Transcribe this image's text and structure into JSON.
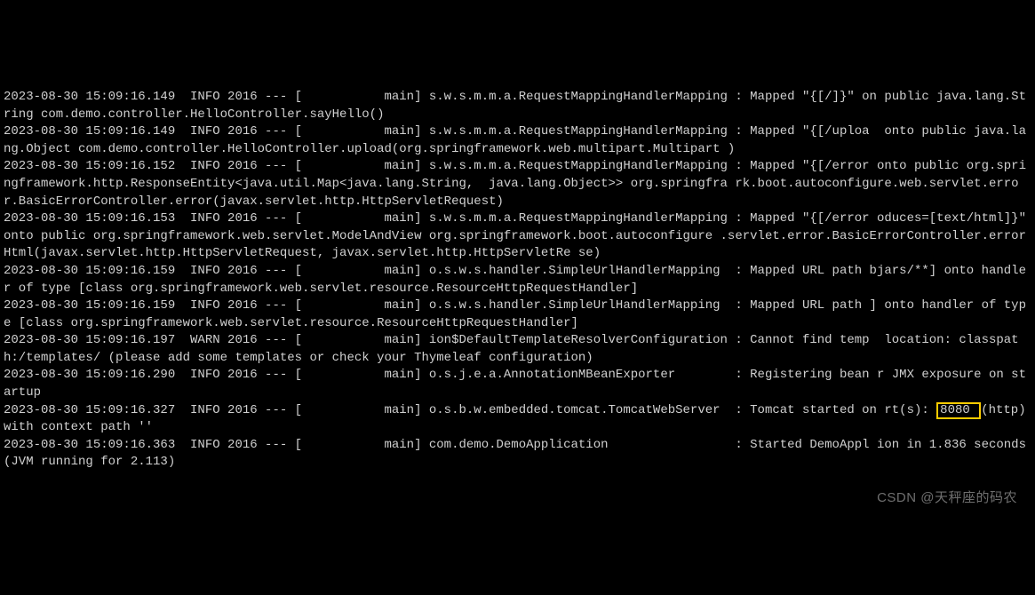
{
  "terminal": {
    "lines": [
      {
        "text": "2023-08-30 15:09:16.149  INFO 2016 --- [           main] s.w.s.m.m.a.RequestMappingHandlerMapping : Mapped \"{[/]}\" on public java.lang.String com.demo.controller.HelloController.sayHello()"
      },
      {
        "text": "2023-08-30 15:09:16.149  INFO 2016 --- [           main] s.w.s.m.m.a.RequestMappingHandlerMapping : Mapped \"{[/uploa  onto public java.lang.Object com.demo.controller.HelloController.upload(org.springframework.web.multipart.Multipart )"
      },
      {
        "text": "2023-08-30 15:09:16.152  INFO 2016 --- [           main] s.w.s.m.m.a.RequestMappingHandlerMapping : Mapped \"{[/error onto public org.springframework.http.ResponseEntity<java.util.Map<java.lang.String,  java.lang.Object>> org.springfra rk.boot.autoconfigure.web.servlet.error.BasicErrorController.error(javax.servlet.http.HttpServletRequest)"
      },
      {
        "text": "2023-08-30 15:09:16.153  INFO 2016 --- [           main] s.w.s.m.m.a.RequestMappingHandlerMapping : Mapped \"{[/error oduces=[text/html]}\" onto public org.springframework.web.servlet.ModelAndView org.springframework.boot.autoconfigure .servlet.error.BasicErrorController.errorHtml(javax.servlet.http.HttpServletRequest, javax.servlet.http.HttpServletRe se)"
      },
      {
        "text": "2023-08-30 15:09:16.159  INFO 2016 --- [           main] o.s.w.s.handler.SimpleUrlHandlerMapping  : Mapped URL path bjars/**] onto handler of type [class org.springframework.web.servlet.resource.ResourceHttpRequestHandler]"
      },
      {
        "text": "2023-08-30 15:09:16.159  INFO 2016 --- [           main] o.s.w.s.handler.SimpleUrlHandlerMapping  : Mapped URL path ] onto handler of type [class org.springframework.web.servlet.resource.ResourceHttpRequestHandler]"
      },
      {
        "text": "2023-08-30 15:09:16.197  WARN 2016 --- [           main] ion$DefaultTemplateResolverConfiguration : Cannot find temp  location: classpath:/templates/ (please add some templates or check your Thymeleaf configuration)"
      },
      {
        "text": "2023-08-30 15:09:16.290  INFO 2016 --- [           main] o.s.j.e.a.AnnotationMBeanExporter        : Registering bean r JMX exposure on startup"
      },
      {
        "prefix": "2023-08-30 15:09:16.327  INFO 2016 --- [           main] o.s.b.w.embedded.tomcat.TomcatWebServer  : Tomcat started on rt(s): ",
        "highlight": "8080 ",
        "suffix": "(http) with context path ''"
      },
      {
        "text": "2023-08-30 15:09:16.363  INFO 2016 --- [           main] com.demo.DemoApplication                 : Started DemoAppl ion in 1.836 seconds (JVM running for 2.113)"
      }
    ],
    "port_highlighted": "8080"
  },
  "watermark": "CSDN @天秤座的码农"
}
